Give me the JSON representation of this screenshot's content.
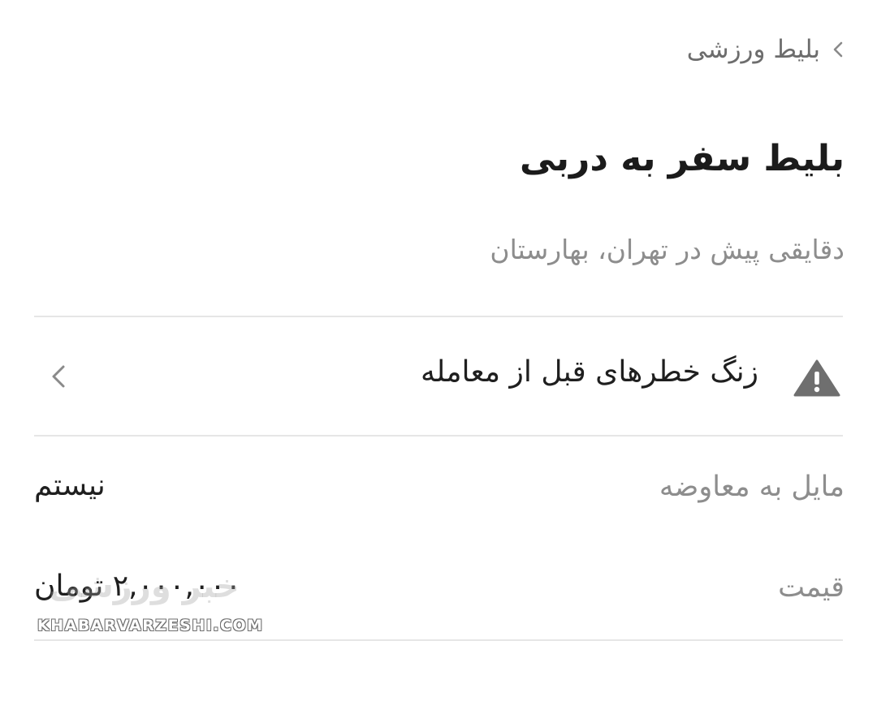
{
  "breadcrumb": {
    "label": "بلیط ورزشی",
    "icon": "chevron-left-icon"
  },
  "listing": {
    "title": "بلیط سفر به دربی",
    "subtitle": "دقایقی پیش در تهران، بهارستان"
  },
  "warning": {
    "label": "زنگ خطرهای قبل از معامله",
    "icon": "warning-triangle-icon",
    "chevron_icon": "chevron-left-icon"
  },
  "details": [
    {
      "key": "مایل به معاوضه",
      "value": "نیستم"
    },
    {
      "key": "قیمت",
      "value": "۲,۰۰۰,۰۰۰ تومان"
    }
  ],
  "watermark": {
    "text": "KHABARVARZESHI.COM",
    "logo_text": "خبر ورزشی"
  },
  "colors": {
    "title": "#1b1b1b",
    "muted": "#8d8d8d",
    "divider": "#e6e6e6",
    "icon": "#6f6f6f"
  }
}
